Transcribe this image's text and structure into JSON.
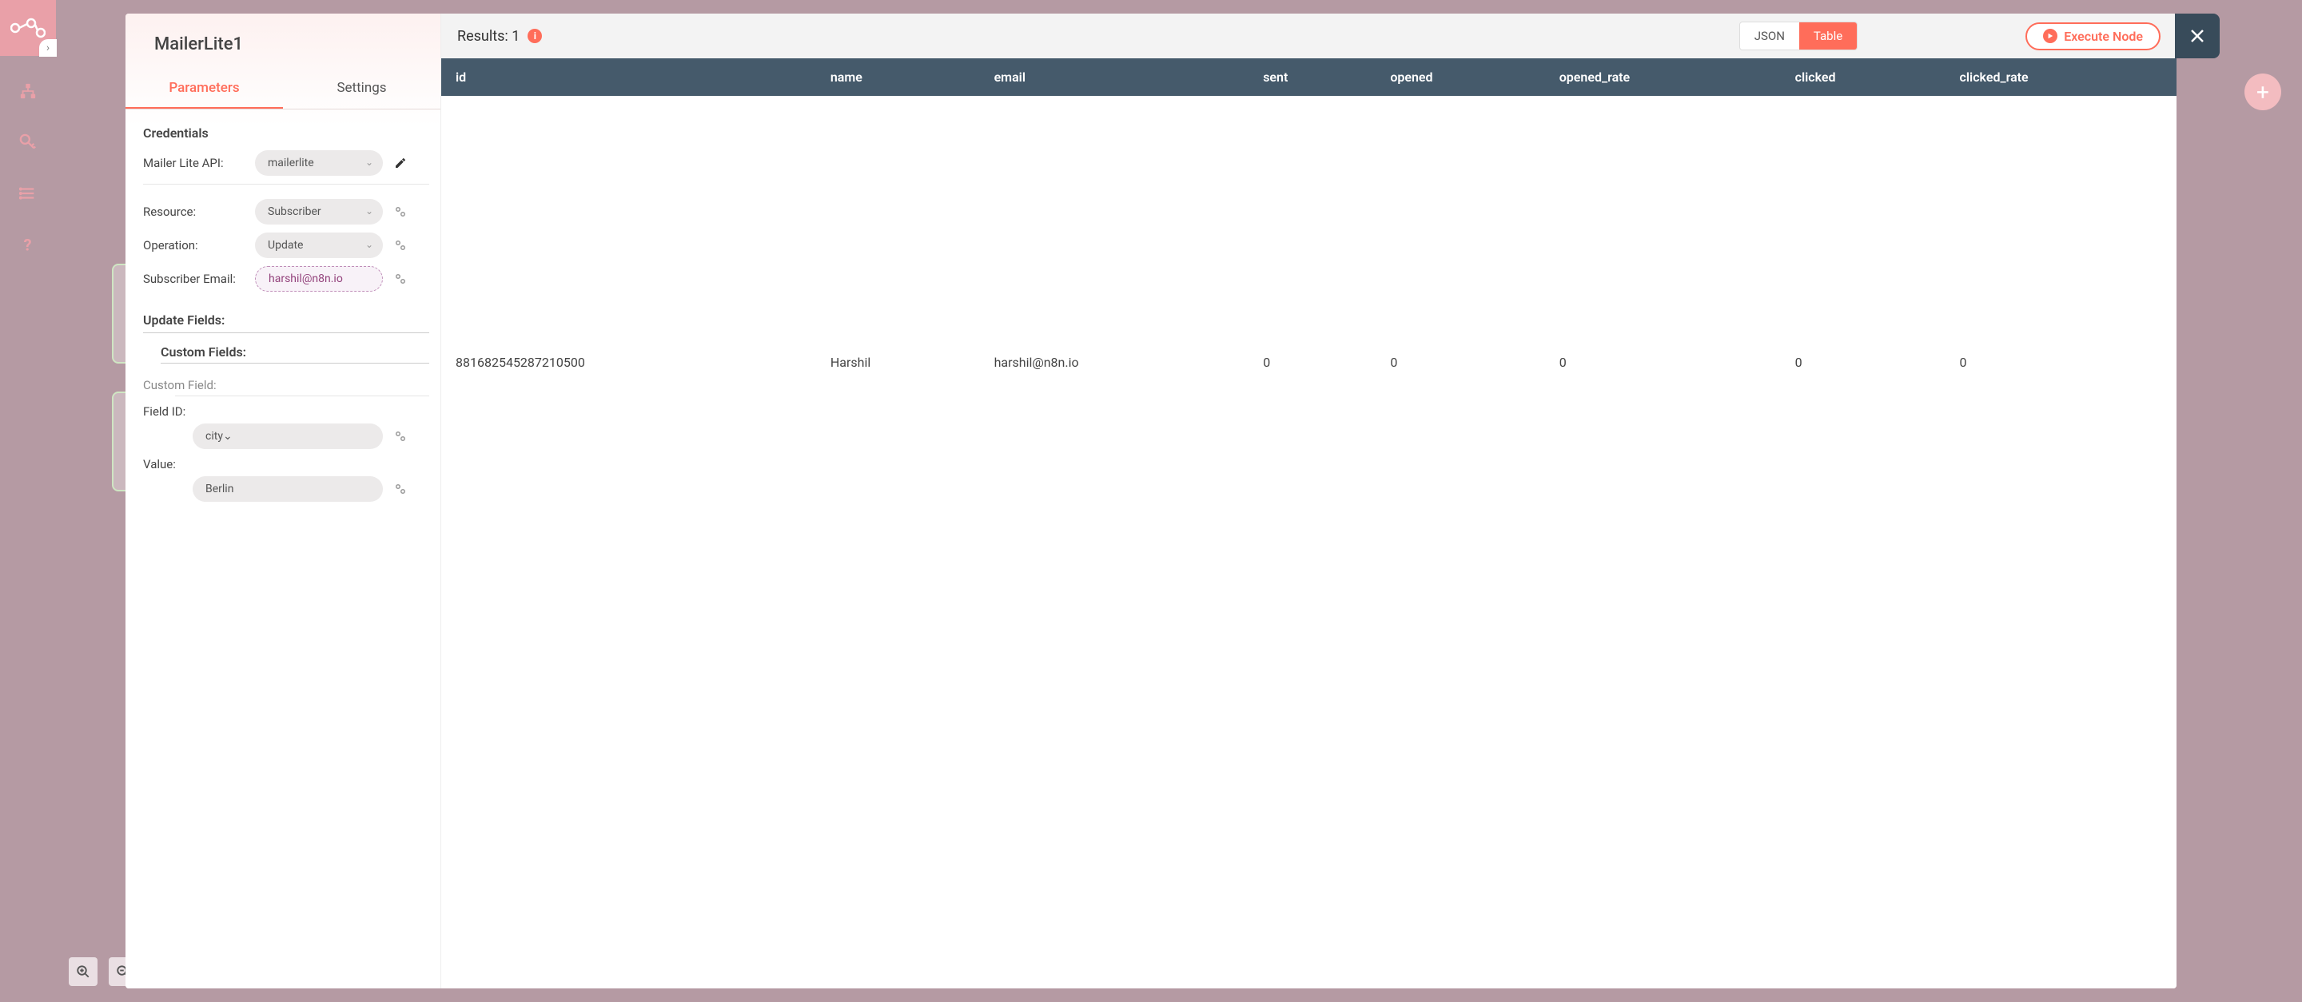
{
  "node": {
    "title": "MailerLite1",
    "tabs": {
      "parameters": "Parameters",
      "settings": "Settings"
    }
  },
  "panel": {
    "credentials_header": "Credentials",
    "cred_label": "Mailer Lite API:",
    "cred_value": "mailerlite",
    "resource_label": "Resource:",
    "resource_value": "Subscriber",
    "operation_label": "Operation:",
    "operation_value": "Update",
    "sub_email_label": "Subscriber Email:",
    "sub_email_value": "harshil@n8n.io",
    "update_fields_header": "Update Fields:",
    "custom_fields_header": "Custom Fields:",
    "custom_field_label": "Custom Field:",
    "field_id_label": "Field ID:",
    "field_id_value": "city",
    "value_label": "Value:",
    "value_value": "Berlin"
  },
  "results": {
    "label": "Results: 1",
    "view_json": "JSON",
    "view_table": "Table",
    "execute_label": "Execute Node"
  },
  "table": {
    "headers": [
      "id",
      "name",
      "email",
      "sent",
      "opened",
      "opened_rate",
      "clicked",
      "clicked_rate"
    ],
    "row": {
      "id": "881682545287210500",
      "name": "Harshil",
      "email": "harshil@n8n.io",
      "sent": "0",
      "opened": "0",
      "opened_rate": "0",
      "clicked": "0",
      "clicked_rate": "0"
    }
  }
}
